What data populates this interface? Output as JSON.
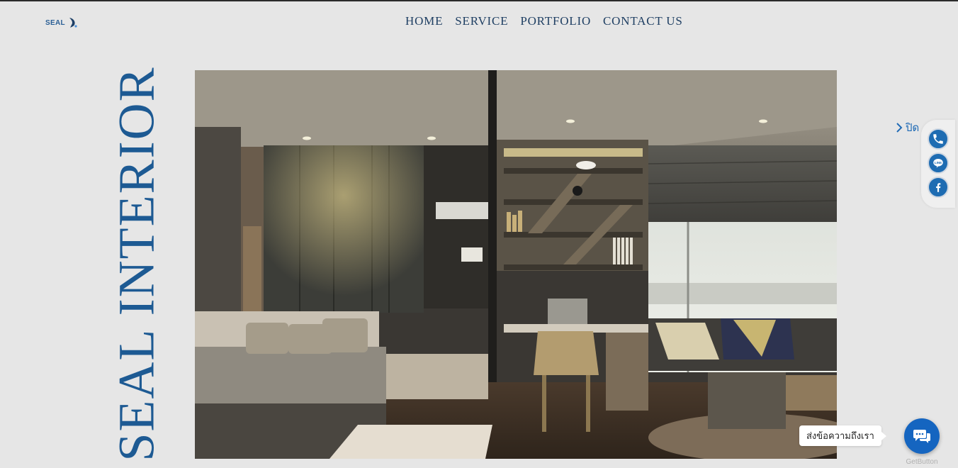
{
  "brand": {
    "logo_text": "SEAL",
    "vertical_title": "SEAL INTERIOR"
  },
  "nav": {
    "items": [
      "HOME",
      "SERVICE",
      "PORTFOLIO",
      "CONTACT US"
    ]
  },
  "hero": {
    "image_subject": "modern bedroom and study interior rendering"
  },
  "social": {
    "close_label": "ปิด",
    "buttons": [
      {
        "icon": "phone-icon",
        "color": "#1e6cb2"
      },
      {
        "icon": "line-icon",
        "color": "#1e6cb2"
      },
      {
        "icon": "facebook-icon",
        "color": "#1e6cb2"
      }
    ]
  },
  "chat": {
    "bubble_text": "ส่งข้อความถึงเรา",
    "powered_by": "GetButton"
  },
  "colors": {
    "background": "#e6e6e6",
    "brand_blue": "#1d5a93",
    "nav_text": "#1f3f63",
    "chat_blue": "#1565c0"
  }
}
